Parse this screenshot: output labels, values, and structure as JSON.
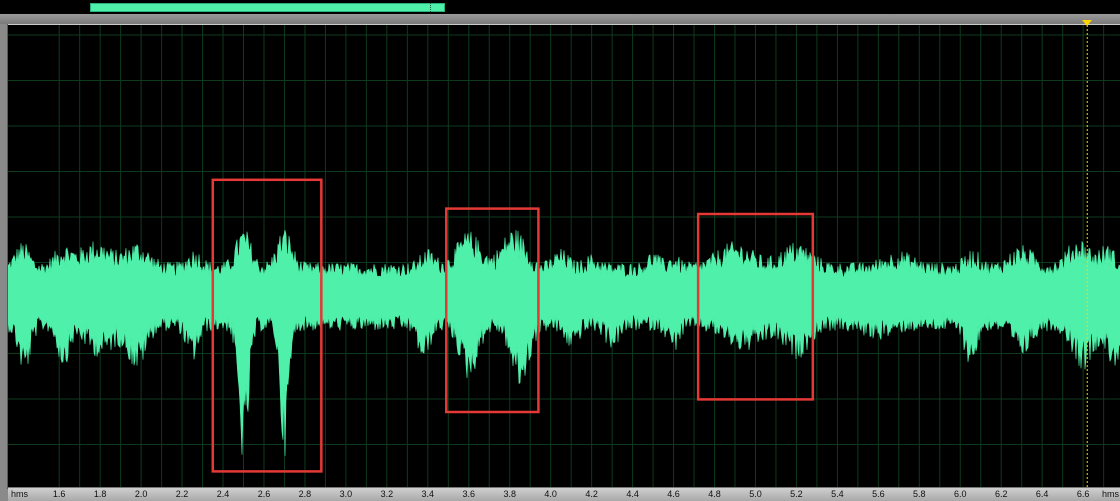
{
  "ruler": {
    "unit_left": "hms",
    "unit_right": "hms",
    "ticks": [
      "1.6",
      "1.8",
      "2.0",
      "2.2",
      "2.4",
      "2.6",
      "2.8",
      "3.0",
      "3.2",
      "3.4",
      "3.6",
      "3.8",
      "4.0",
      "4.2",
      "4.4",
      "4.6",
      "4.8",
      "5.0",
      "5.2",
      "5.4",
      "5.6",
      "5.8",
      "6.0",
      "6.2",
      "6.4",
      "6.6"
    ]
  },
  "view": {
    "time_start": 1.35,
    "time_end": 6.78,
    "playhead_time": 6.62,
    "overview_fraction": [
      0.08,
      0.397
    ]
  },
  "highlights": [
    {
      "label": "",
      "t_start": 2.35,
      "t_end": 2.88,
      "amp_top": 0.64,
      "amp_bottom": -0.98
    },
    {
      "label": "",
      "t_start": 3.49,
      "t_end": 3.94,
      "amp_top": 0.48,
      "amp_bottom": -0.65
    },
    {
      "label": "",
      "t_start": 4.72,
      "t_end": 5.28,
      "amp_top": 0.45,
      "amp_bottom": -0.58
    }
  ],
  "colors": {
    "waveform": "#4ff0a9",
    "background": "#000000",
    "grid": "#0e3a1e",
    "highlight": "#e53935",
    "playhead": "#ffd400"
  }
}
